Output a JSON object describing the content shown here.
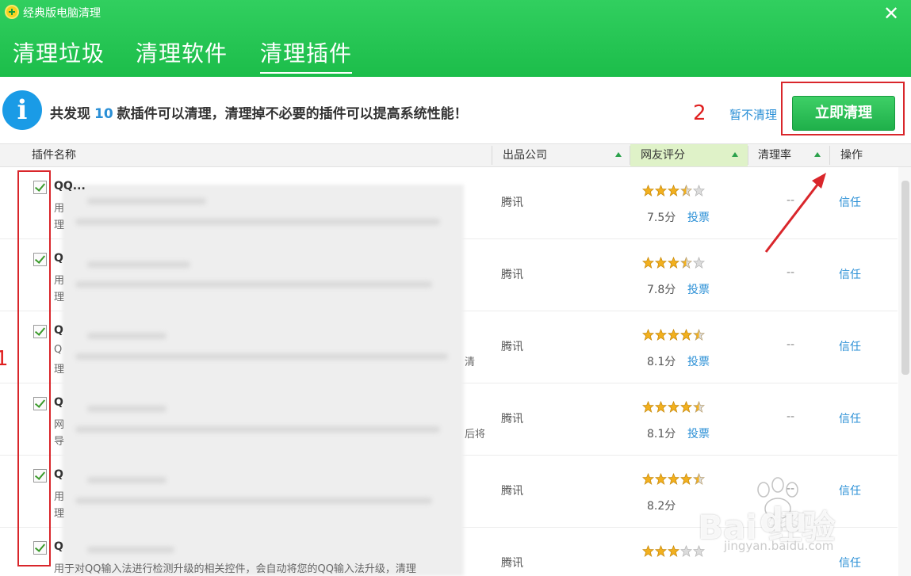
{
  "window": {
    "title": "经典版电脑清理",
    "close_glyph": "✕"
  },
  "tabs": [
    {
      "label": "清理垃圾"
    },
    {
      "label": "清理软件"
    },
    {
      "label": "清理插件"
    }
  ],
  "info": {
    "prefix": "共发现",
    "count": "10",
    "suffix": "款插件可以清理，清理掉不必要的插件可以提高系统性能！",
    "skip_label": "暂不清理",
    "clean_label": "立即清理"
  },
  "table": {
    "columns": [
      "插件名称",
      "出品公司",
      "网友评分",
      "清理率",
      "操作"
    ],
    "rows": [
      {
        "name": "QQ...",
        "desc": "用",
        "desc2": "理",
        "desc_tail": "",
        "company": "腾讯",
        "stars": 3.5,
        "score": "7.5分",
        "vote": "投票",
        "rate": "--",
        "action": "信任"
      },
      {
        "name": "Q",
        "desc": "用",
        "desc2": "理",
        "desc_tail": "",
        "company": "腾讯",
        "stars": 3.5,
        "score": "7.8分",
        "vote": "投票",
        "rate": "--",
        "action": "信任"
      },
      {
        "name": "Q",
        "desc": "Q",
        "desc2": "理",
        "desc_tail": "清",
        "company": "腾讯",
        "stars": 4.5,
        "score": "8.1分",
        "vote": "投票",
        "rate": "--",
        "action": "信任"
      },
      {
        "name": "Q",
        "desc": "网",
        "desc2": "导",
        "desc_tail": "后将",
        "company": "腾讯",
        "stars": 4.5,
        "score": "8.1分",
        "vote": "投票",
        "rate": "--",
        "action": "信任"
      },
      {
        "name": "Q",
        "desc": "用",
        "desc2": "理",
        "desc_tail": "",
        "company": "腾讯",
        "stars": 4.5,
        "score": "8.2分",
        "vote": "",
        "rate": "--",
        "action": "信任"
      },
      {
        "name": "Q",
        "desc": "用于对QQ输入法进行检测升级的相关控件，会自动将您的QQ输入法升级，清理",
        "desc2": "",
        "desc_tail": "",
        "company": "腾讯",
        "stars": 3,
        "score": "",
        "vote": "",
        "rate": "",
        "action": "信任"
      }
    ]
  },
  "annotations": {
    "one": "1",
    "two": "2"
  },
  "watermark": {
    "brand": "Bai 经验",
    "brand_du": "du",
    "url": "jingyan.baidu.com"
  },
  "colors": {
    "header_green": "#22c350",
    "accent_blue": "#2a8fd6",
    "annotation_red": "#d9262b",
    "star_gold": "#f2b01e"
  }
}
